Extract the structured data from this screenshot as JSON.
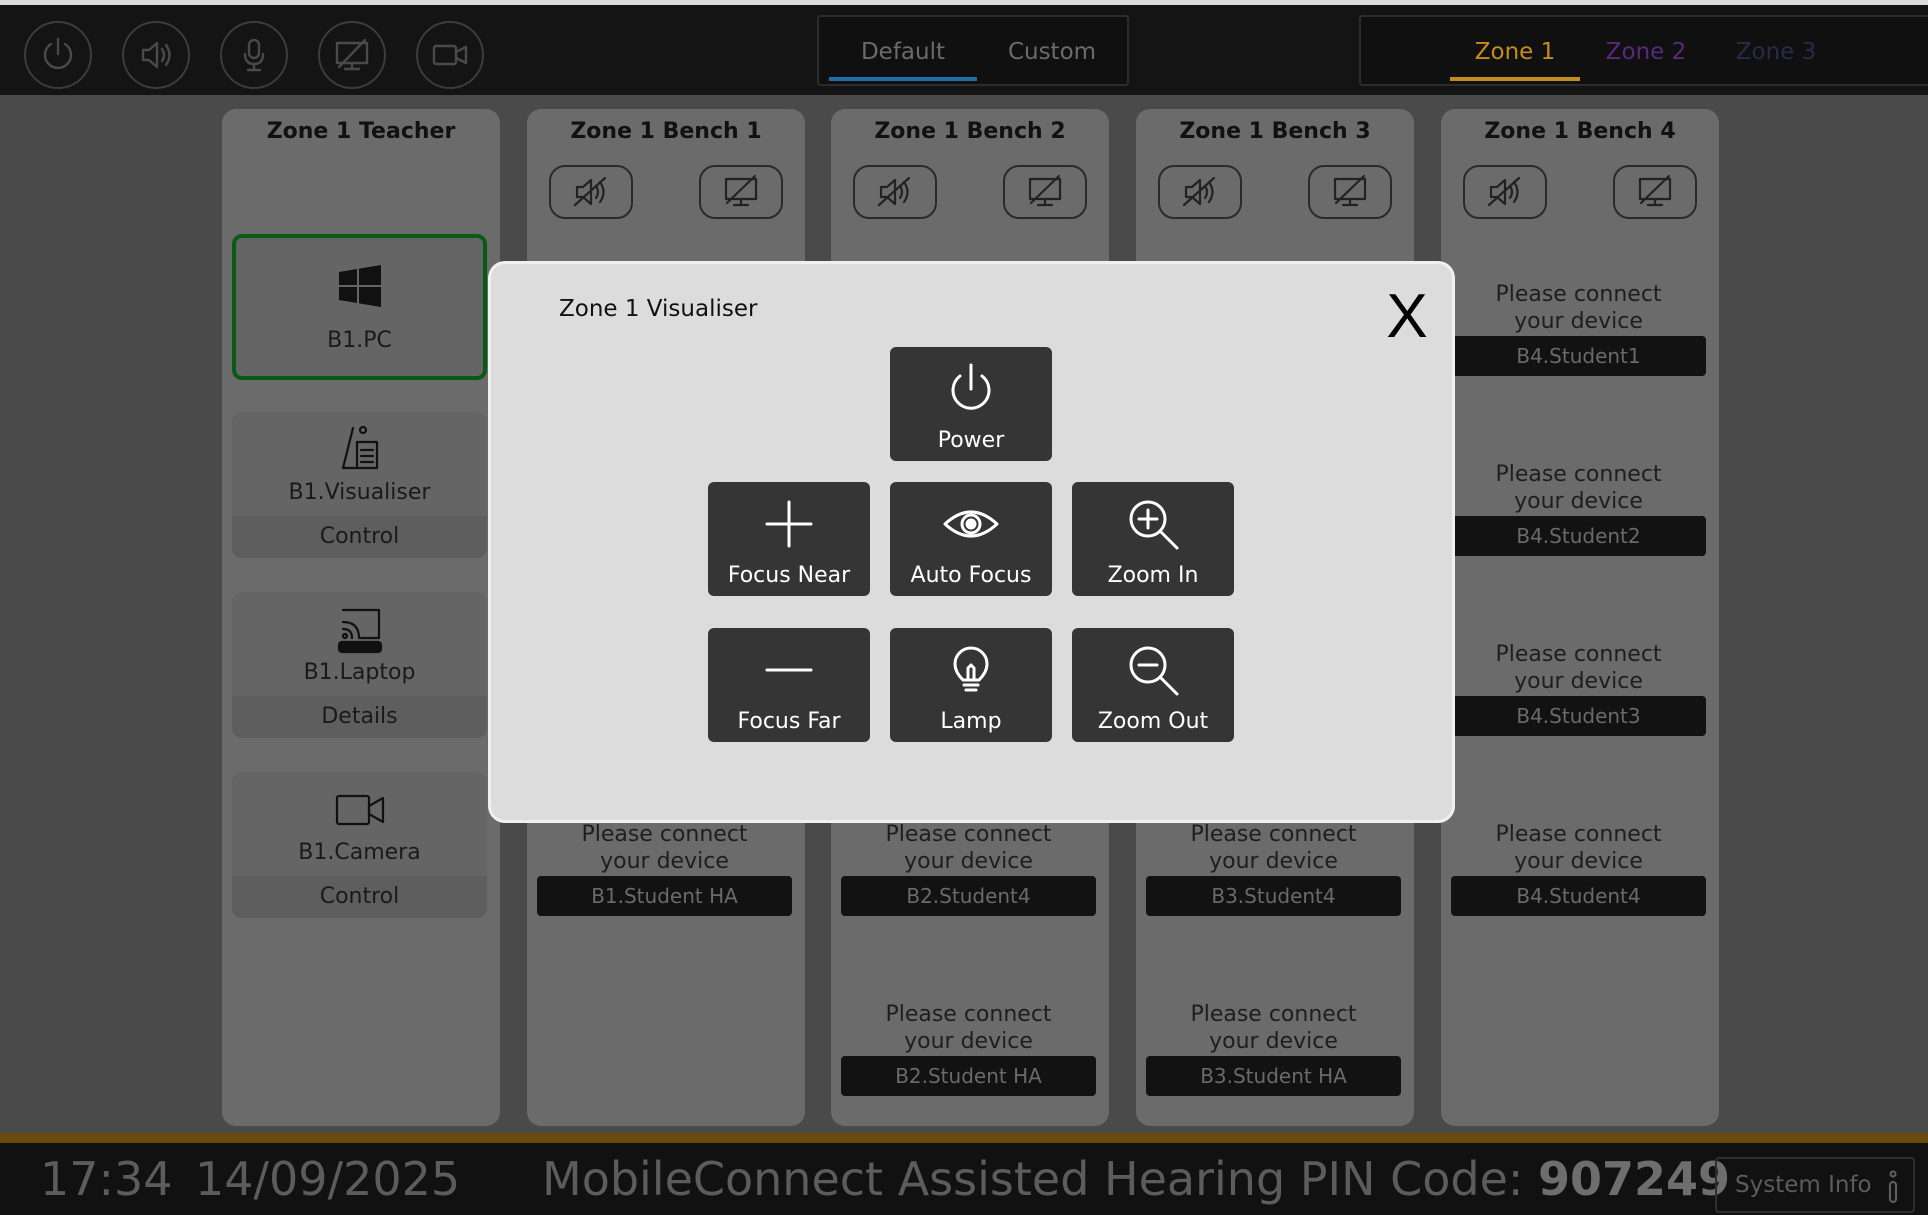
{
  "top_bar": {
    "round_buttons": [
      "power-icon",
      "speaker-icon",
      "microphone-icon",
      "display-icon",
      "camera-icon"
    ],
    "mode_tabs": [
      {
        "label": "Default",
        "active": true
      },
      {
        "label": "Custom",
        "active": false
      }
    ],
    "zone_tabs": [
      {
        "label": "Zone 1",
        "color": "#c48c1c",
        "active": true
      },
      {
        "label": "Zone 2",
        "color": "#5a2a7a",
        "active": false
      },
      {
        "label": "Zone 3",
        "color": "#2a2a4a",
        "active": false
      }
    ]
  },
  "columns": [
    {
      "title": "Zone 1 Teacher",
      "devices": [
        {
          "name": "B1.PC",
          "icon": "windows-icon",
          "selected": true
        },
        {
          "name": "B1.Visualiser",
          "icon": "visualiser-icon",
          "sub": "Control"
        },
        {
          "name": "B1.Laptop",
          "icon": "cast-icon",
          "sub": "Details"
        },
        {
          "name": "B1.Camera",
          "icon": "camera-icon",
          "sub": "Control"
        }
      ]
    },
    {
      "title": "Zone 1 Bench 1",
      "slots": [
        {
          "msg_line1": "Please connect",
          "msg_line2": "your device",
          "label": "B1.Student HA"
        }
      ]
    },
    {
      "title": "Zone 1 Bench 2",
      "slots": [
        {
          "msg_line1": "Please connect",
          "msg_line2": "your device",
          "label": "B2.Student4"
        },
        {
          "msg_line1": "Please connect",
          "msg_line2": "your device",
          "label": "B2.Student HA"
        }
      ]
    },
    {
      "title": "Zone 1 Bench 3",
      "slots": [
        {
          "msg_line1": "Please connect",
          "msg_line2": "your device",
          "label": "B3.Student4"
        },
        {
          "msg_line1": "Please connect",
          "msg_line2": "your device",
          "label": "B3.Student HA"
        }
      ]
    },
    {
      "title": "Zone 1 Bench 4",
      "slots": [
        {
          "msg_line1": "Please connect",
          "msg_line2": "your device",
          "label": "B4.Student1"
        },
        {
          "msg_line1": "Please connect",
          "msg_line2": "your device",
          "label": "B4.Student2"
        },
        {
          "msg_line1": "Please connect",
          "msg_line2": "your device",
          "label": "B4.Student3"
        },
        {
          "msg_line1": "Please connect",
          "msg_line2": "your device",
          "label": "B4.Student4"
        }
      ]
    }
  ],
  "bench_icons": [
    "speaker-muted-icon",
    "display-off-icon"
  ],
  "modal": {
    "title": "Zone 1 Visualiser",
    "close": "X",
    "buttons": {
      "power": "Power",
      "focus_near": "Focus Near",
      "auto_focus": "Auto Focus",
      "zoom_in": "Zoom In",
      "focus_far": "Focus Far",
      "lamp": "Lamp",
      "zoom_out": "Zoom Out"
    }
  },
  "bottom_bar": {
    "time": "17:34",
    "date": "14/09/2025",
    "pin_label": "MobileConnect Assisted Hearing PIN Code:",
    "pin_code": "907249",
    "system_info": "System Info",
    "accent_color": "#c48c1c"
  }
}
